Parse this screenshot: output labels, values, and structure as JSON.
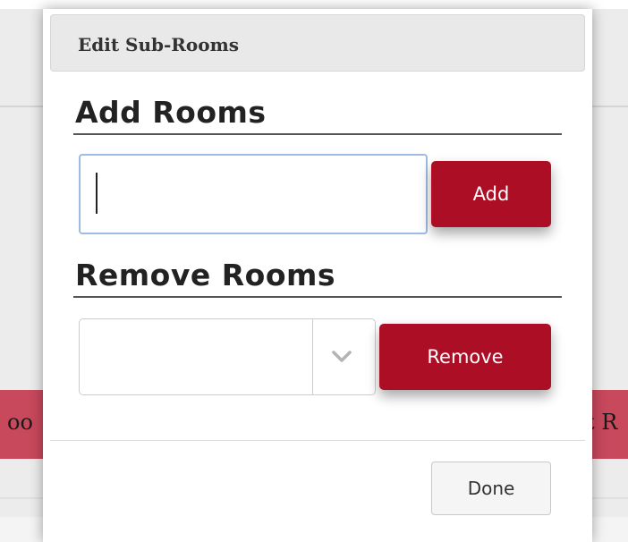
{
  "background": {
    "left_fragment": "oo",
    "right_fragment": "t R"
  },
  "dialog": {
    "title": "Edit Sub-Rooms",
    "add_section": {
      "heading": "Add Rooms",
      "input_value": "",
      "button_label": "Add"
    },
    "remove_section": {
      "heading": "Remove Rooms",
      "select_value": "",
      "button_label": "Remove"
    },
    "footer": {
      "done_label": "Done"
    }
  },
  "colors": {
    "accent": "#ac0e26",
    "background_stripe": "#c8485c",
    "input_focus_border": "#9dbbe4"
  },
  "icons": {
    "select_arrow": "chevron-down-icon"
  }
}
